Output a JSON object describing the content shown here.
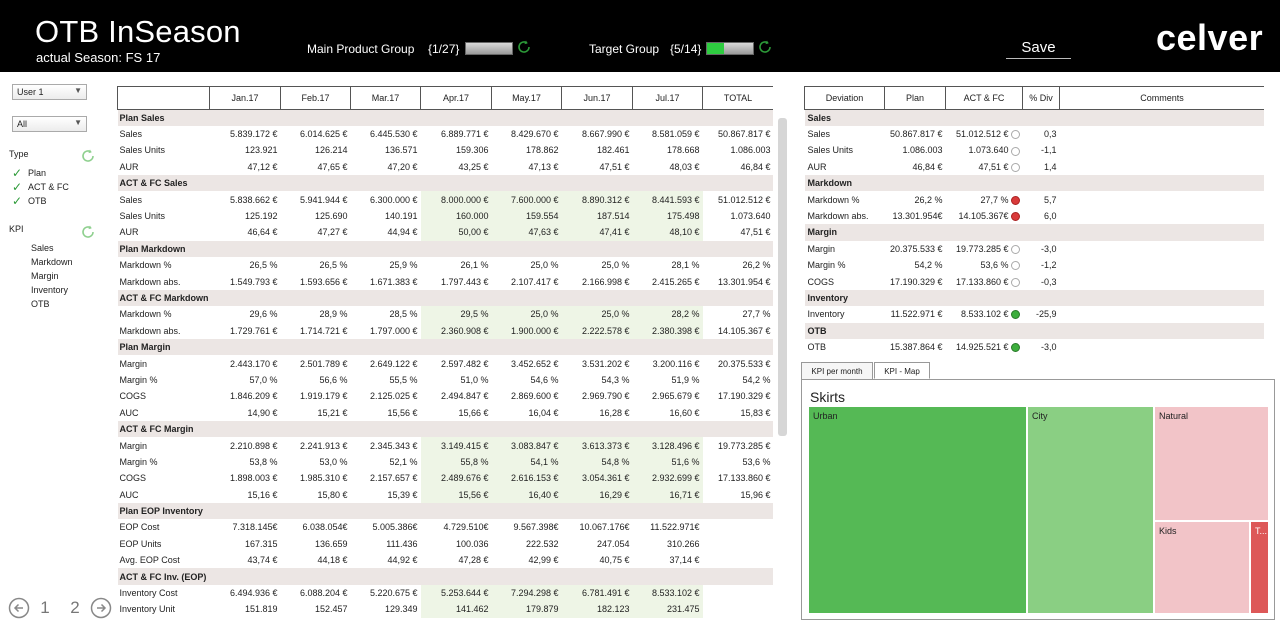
{
  "header": {
    "title": "OTB InSeason",
    "season": "actual Season: FS 17",
    "main_group_label": "Main Product Group",
    "main_group_count": "{1/27}",
    "main_group_progress": 0.0,
    "target_group_label": "Target Group",
    "target_group_count": "{5/14}",
    "target_group_progress": 0.36,
    "save_label": "Save",
    "brand": "celver"
  },
  "sidebar": {
    "user_select": "User 1",
    "filter_select": "All",
    "type_heading": "Type",
    "type_items": [
      "Plan",
      "ACT & FC",
      "OTB"
    ],
    "kpi_heading": "KPI",
    "kpi_items": [
      "Sales",
      "Markdown",
      "Margin",
      "Inventory",
      "OTB"
    ],
    "pages": [
      "1",
      "2"
    ]
  },
  "grid": {
    "columns": [
      "",
      "Jan.17",
      "Feb.17",
      "Mar.17",
      "Apr.17",
      "May.17",
      "Jun.17",
      "Jul.17",
      "TOTAL"
    ],
    "rows": [
      {
        "section": "Plan Sales"
      },
      {
        "label": "Sales",
        "values": [
          "5.839.172 €",
          "6.014.625 €",
          "6.445.530 €",
          "6.889.771 €",
          "8.429.670 €",
          "8.667.990 €",
          "8.581.059 €",
          "50.867.817 €"
        ]
      },
      {
        "label": "Sales Units",
        "values": [
          "123.921",
          "126.214",
          "136.571",
          "159.306",
          "178.862",
          "182.461",
          "178.668",
          "1.086.003"
        ]
      },
      {
        "label": "AUR",
        "values": [
          "47,12 €",
          "47,65 €",
          "47,20 €",
          "43,25 €",
          "47,13 €",
          "47,51 €",
          "48,03 €",
          "46,84 €"
        ]
      },
      {
        "section": "ACT & FC Sales"
      },
      {
        "label": "Sales",
        "values": [
          "5.838.662 €",
          "5.941.944 €",
          "6.300.000 €",
          "8.000.000 €",
          "7.600.000 €",
          "8.890.312 €",
          "8.441.593 €",
          "51.012.512 €"
        ],
        "hl": [
          3,
          4,
          5,
          6
        ]
      },
      {
        "label": "Sales Units",
        "values": [
          "125.192",
          "125.690",
          "140.191",
          "160.000",
          "159.554",
          "187.514",
          "175.498",
          "1.073.640"
        ],
        "hl": [
          3,
          4,
          5,
          6
        ]
      },
      {
        "label": "AUR",
        "values": [
          "46,64 €",
          "47,27 €",
          "44,94 €",
          "50,00 €",
          "47,63 €",
          "47,41 €",
          "48,10 €",
          "47,51 €"
        ],
        "hl": [
          3,
          4,
          5,
          6
        ]
      },
      {
        "section": "Plan Markdown"
      },
      {
        "label": "Markdown %",
        "values": [
          "26,5 %",
          "26,5 %",
          "25,9 %",
          "26,1 %",
          "25,0 %",
          "25,0 %",
          "28,1 %",
          "26,2 %"
        ]
      },
      {
        "label": "Markdown abs.",
        "values": [
          "1.549.793 €",
          "1.593.656 €",
          "1.671.383 €",
          "1.797.443 €",
          "2.107.417 €",
          "2.166.998 €",
          "2.415.265 €",
          "13.301.954 €"
        ]
      },
      {
        "section": "ACT & FC Markdown"
      },
      {
        "label": "Markdown %",
        "values": [
          "29,6 %",
          "28,9 %",
          "28,5 %",
          "29,5 %",
          "25,0 %",
          "25,0 %",
          "28,2 %",
          "27,7 %"
        ],
        "hl": [
          3,
          4,
          5,
          6
        ]
      },
      {
        "label": "Markdown abs.",
        "values": [
          "1.729.761 €",
          "1.714.721 €",
          "1.797.000 €",
          "2.360.908 €",
          "1.900.000 €",
          "2.222.578 €",
          "2.380.398 €",
          "14.105.367 €"
        ],
        "hl": [
          3,
          4,
          5,
          6
        ]
      },
      {
        "section": "Plan Margin"
      },
      {
        "label": "Margin",
        "values": [
          "2.443.170 €",
          "2.501.789 €",
          "2.649.122 €",
          "2.597.482 €",
          "3.452.652 €",
          "3.531.202 €",
          "3.200.116 €",
          "20.375.533 €"
        ]
      },
      {
        "label": "Margin %",
        "values": [
          "57,0 %",
          "56,6 %",
          "55,5 %",
          "51,0 %",
          "54,6 %",
          "54,3 %",
          "51,9 %",
          "54,2 %"
        ]
      },
      {
        "label": "COGS",
        "values": [
          "1.846.209 €",
          "1.919.179 €",
          "2.125.025 €",
          "2.494.847 €",
          "2.869.600 €",
          "2.969.790 €",
          "2.965.679 €",
          "17.190.329 €"
        ]
      },
      {
        "label": "AUC",
        "values": [
          "14,90 €",
          "15,21 €",
          "15,56 €",
          "15,66 €",
          "16,04 €",
          "16,28 €",
          "16,60 €",
          "15,83 €"
        ]
      },
      {
        "section": "ACT & FC Margin"
      },
      {
        "label": "Margin",
        "values": [
          "2.210.898 €",
          "2.241.913 €",
          "2.345.343 €",
          "3.149.415 €",
          "3.083.847 €",
          "3.613.373 €",
          "3.128.496 €",
          "19.773.285 €"
        ],
        "hl": [
          3,
          4,
          5,
          6
        ]
      },
      {
        "label": "Margin %",
        "values": [
          "53,8 %",
          "53,0 %",
          "52,1 %",
          "55,8 %",
          "54,1 %",
          "54,8 %",
          "51,6 %",
          "53,6 %"
        ],
        "hl": [
          3,
          4,
          5,
          6
        ]
      },
      {
        "label": "COGS",
        "values": [
          "1.898.003 €",
          "1.985.310 €",
          "2.157.657 €",
          "2.489.676 €",
          "2.616.153 €",
          "3.054.361 €",
          "2.932.699 €",
          "17.133.860 €"
        ],
        "hl": [
          3,
          4,
          5,
          6
        ]
      },
      {
        "label": "AUC",
        "values": [
          "15,16 €",
          "15,80 €",
          "15,39 €",
          "15,56 €",
          "16,40 €",
          "16,29 €",
          "16,71 €",
          "15,96 €"
        ],
        "hl": [
          3,
          4,
          5,
          6
        ]
      },
      {
        "section": "Plan EOP Inventory"
      },
      {
        "label": "EOP Cost",
        "values": [
          "7.318.145€",
          "6.038.054€",
          "5.005.386€",
          "4.729.510€",
          "9.567.398€",
          "10.067.176€",
          "11.522.971€",
          ""
        ]
      },
      {
        "label": "EOP Units",
        "values": [
          "167.315",
          "136.659",
          "111.436",
          "100.036",
          "222.532",
          "247.054",
          "310.266",
          ""
        ]
      },
      {
        "label": "Avg. EOP Cost",
        "values": [
          "43,74 €",
          "44,18 €",
          "44,92 €",
          "47,28 €",
          "42,99 €",
          "40,75 €",
          "37,14 €",
          ""
        ]
      },
      {
        "section": "ACT & FC Inv. (EOP)"
      },
      {
        "label": "Inventory Cost",
        "values": [
          "6.494.936 €",
          "6.088.204 €",
          "5.220.675 €",
          "5.253.644 €",
          "7.294.298 €",
          "6.781.491 €",
          "8.533.102 €",
          ""
        ],
        "hl": [
          3,
          4,
          5,
          6
        ]
      },
      {
        "label": "Inventory Unit",
        "values": [
          "151.819",
          "152.457",
          "129.349",
          "141.462",
          "179.879",
          "182.123",
          "231.475",
          ""
        ],
        "hl": [
          3,
          4,
          5,
          6
        ]
      }
    ]
  },
  "deviation": {
    "columns": [
      "Deviation",
      "Plan",
      "ACT & FC",
      "% Div",
      "Comments"
    ],
    "rows": [
      {
        "section": "Sales"
      },
      {
        "label": "Sales",
        "plan": "50.867.817 €",
        "act": "51.012.512 €",
        "status": "neutral",
        "div": "0,3"
      },
      {
        "label": "Sales Units",
        "plan": "1.086.003",
        "act": "1.073.640",
        "status": "neutral",
        "div": "-1,1"
      },
      {
        "label": "AUR",
        "plan": "46,84 €",
        "act": "47,51 €",
        "status": "neutral",
        "div": "1,4"
      },
      {
        "section": "Markdown"
      },
      {
        "label": "Markdown %",
        "plan": "26,2 %",
        "act": "27,7 %",
        "status": "red",
        "div": "5,7"
      },
      {
        "label": "Markdown abs.",
        "plan": "13.301.954€",
        "act": "14.105.367€",
        "status": "red",
        "div": "6,0"
      },
      {
        "section": "Margin"
      },
      {
        "label": "Margin",
        "plan": "20.375.533 €",
        "act": "19.773.285 €",
        "status": "neutral",
        "div": "-3,0"
      },
      {
        "label": "Margin %",
        "plan": "54,2 %",
        "act": "53,6 %",
        "status": "neutral",
        "div": "-1,2"
      },
      {
        "label": "COGS",
        "plan": "17.190.329 €",
        "act": "17.133.860 €",
        "status": "neutral",
        "div": "-0,3"
      },
      {
        "section": "Inventory"
      },
      {
        "label": "Inventory",
        "plan": "11.522.971 €",
        "act": "8.533.102 €",
        "status": "green",
        "div": "-25,9"
      },
      {
        "section": "OTB"
      },
      {
        "label": "OTB",
        "plan": "15.387.864 €",
        "act": "14.925.521 €",
        "status": "green",
        "div": "-3,0"
      }
    ]
  },
  "tabs": {
    "kpi_per_month": "KPI per month",
    "kpi_map": "KPI - Map"
  },
  "treemap": {
    "title": "Skirts",
    "tiles": [
      {
        "label": "Urban",
        "color": "#55b955"
      },
      {
        "label": "City",
        "color": "#8acf83"
      },
      {
        "label": "Natural",
        "color": "#f2c4c8"
      },
      {
        "label": "Kids",
        "color": "#f2c4c8"
      },
      {
        "label": "T...",
        "color": "#dd5858"
      }
    ]
  },
  "colors": {
    "accent_green": "#2ecc40",
    "highlight_cell": "#eef5e6",
    "section_bg": "#ece6e4"
  }
}
